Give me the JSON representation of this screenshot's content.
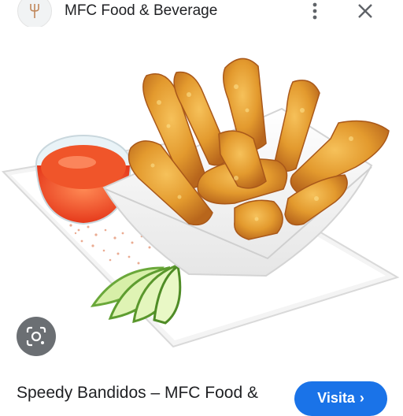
{
  "header": {
    "site_name": "MFC Food & Beverage",
    "logo_icon": "fork-icon",
    "more_icon": "more-vert-icon",
    "close_icon": "close-icon"
  },
  "image": {
    "subject": "chicken-tenders-with-sauce"
  },
  "lens": {
    "icon": "lens-search-icon"
  },
  "result": {
    "title": "Speedy Bandidos – MFC Food &",
    "visit_label": "Visita",
    "visit_chevron": "›"
  },
  "colors": {
    "accent": "#1a73e8",
    "text": "#202124",
    "icon": "#5f6368"
  }
}
